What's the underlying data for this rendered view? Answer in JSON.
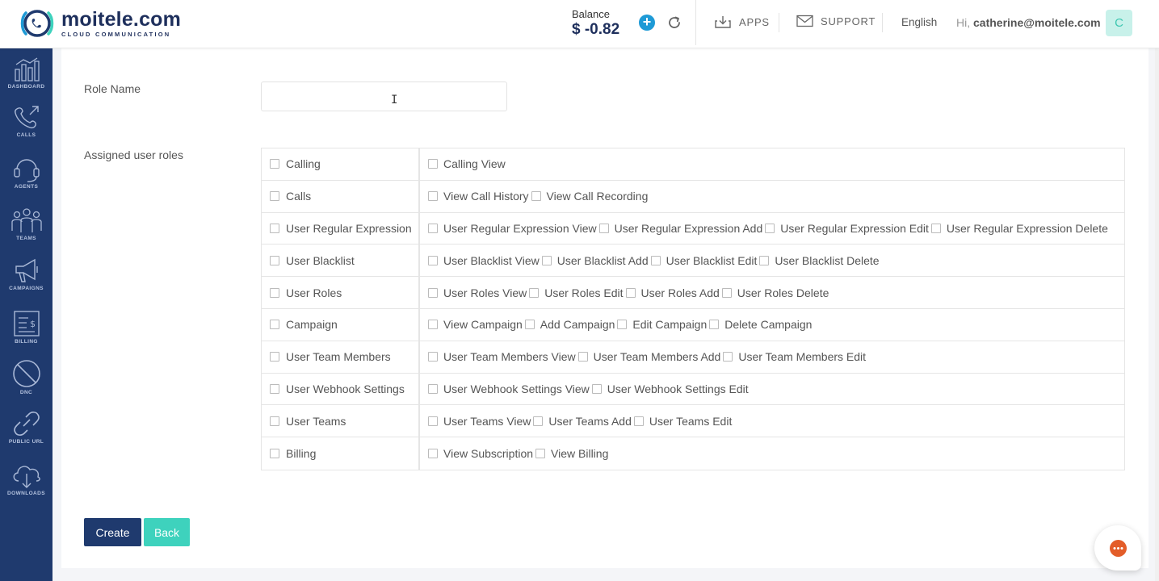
{
  "header": {
    "logo_title": "moitele.com",
    "logo_subtitle": "CLOUD COMMUNICATION",
    "balance_label": "Balance",
    "balance_value": "$ -0.82",
    "apps_label": "APPS",
    "support_label": "SUPPORT",
    "language": "English",
    "greeting_prefix": "Hi,",
    "user_email": "catherine@moitele.com",
    "avatar_initial": "C"
  },
  "sidebar": {
    "items": [
      {
        "label": "DASHBOARD",
        "icon": "dashboard-icon"
      },
      {
        "label": "CALLS",
        "icon": "phone-icon"
      },
      {
        "label": "AGENTS",
        "icon": "headset-icon"
      },
      {
        "label": "TEAMS",
        "icon": "team-icon"
      },
      {
        "label": "CAMPAIGNS",
        "icon": "megaphone-icon"
      },
      {
        "label": "BILLING",
        "icon": "invoice-icon"
      },
      {
        "label": "DNC",
        "icon": "block-icon"
      },
      {
        "label": "PUBLIC URL",
        "icon": "link-icon"
      },
      {
        "label": "DOWNLOADS",
        "icon": "cloud-download-icon"
      }
    ]
  },
  "form": {
    "role_name_label": "Role Name",
    "role_name_value": "",
    "assigned_roles_label": "Assigned user roles",
    "create_label": "Create",
    "back_label": "Back"
  },
  "permissions": [
    {
      "category": "Calling",
      "items": [
        "Calling View"
      ]
    },
    {
      "category": "Calls",
      "items": [
        "View Call History",
        "View Call Recording"
      ]
    },
    {
      "category": "User Regular Expression",
      "items": [
        "User Regular Expression View",
        "User Regular Expression Add",
        "User Regular Expression Edit",
        "User Regular Expression Delete"
      ]
    },
    {
      "category": "User Blacklist",
      "items": [
        "User Blacklist View",
        "User Blacklist Add",
        "User Blacklist Edit",
        "User Blacklist Delete"
      ]
    },
    {
      "category": "User Roles",
      "items": [
        "User Roles View",
        "User Roles Edit",
        "User Roles Add",
        "User Roles Delete"
      ]
    },
    {
      "category": "Campaign",
      "items": [
        "View Campaign",
        "Add Campaign",
        "Edit Campaign",
        "Delete Campaign"
      ]
    },
    {
      "category": "User Team Members",
      "items": [
        "User Team Members View",
        "User Team Members Add",
        "User Team Members Edit"
      ]
    },
    {
      "category": "User Webhook Settings",
      "items": [
        "User Webhook Settings View",
        "User Webhook Settings Edit"
      ]
    },
    {
      "category": "User Teams",
      "items": [
        "User Teams View",
        "User Teams Add",
        "User Teams Edit"
      ]
    },
    {
      "category": "Billing",
      "items": [
        "View Subscription",
        "View Billing"
      ]
    }
  ],
  "colors": {
    "sidebar": "#1f3a6e",
    "primary_button": "#1f3a6e",
    "secondary_button": "#3ed2bd",
    "accent": "#1e9ad6",
    "chat": "#e35d29"
  }
}
